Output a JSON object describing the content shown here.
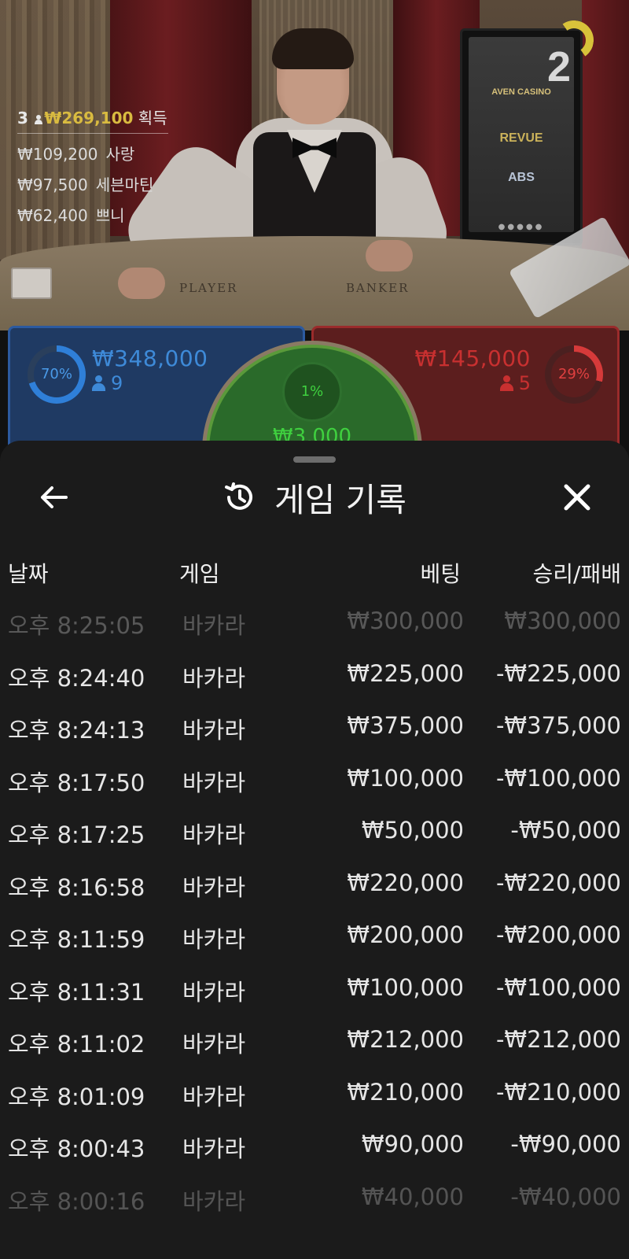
{
  "live": {
    "round_number": "2",
    "table_labels": {
      "player": "PLAYER",
      "banker": "BANKER"
    },
    "sponsors": [
      "AVEN CASINO",
      "REVUE",
      "ABS"
    ],
    "winners": {
      "count": "3",
      "total": "₩269,100",
      "suffix": "획득",
      "list": [
        {
          "amount": "₩109,200",
          "name": "사랑"
        },
        {
          "amount": "₩97,500",
          "name": "세븐마틴"
        },
        {
          "amount": "₩62,400",
          "name": "쁘니"
        }
      ]
    }
  },
  "bets": {
    "player": {
      "percent": "70%",
      "amount": "₩348,000",
      "players": "9",
      "color": "#2f7fd8"
    },
    "banker": {
      "percent": "29%",
      "amount": "₩145,000",
      "players": "5",
      "color": "#d63a3a"
    },
    "tie": {
      "percent": "1%",
      "amount": "₩3,000",
      "color": "#3fd03f"
    }
  },
  "history": {
    "title": "게임 기록",
    "icons": {
      "back": "arrow-left-icon",
      "title": "history-icon",
      "close": "close-icon"
    },
    "columns": {
      "date": "날짜",
      "game": "게임",
      "bet": "베팅",
      "result": "승리/패배"
    },
    "rows": [
      {
        "date": "오후 8:25:05",
        "game": "바카라",
        "bet": "₩300,000",
        "result": "₩300,000"
      },
      {
        "date": "오후 8:24:40",
        "game": "바카라",
        "bet": "₩225,000",
        "result": "-₩225,000"
      },
      {
        "date": "오후 8:24:13",
        "game": "바카라",
        "bet": "₩375,000",
        "result": "-₩375,000"
      },
      {
        "date": "오후 8:17:50",
        "game": "바카라",
        "bet": "₩100,000",
        "result": "-₩100,000"
      },
      {
        "date": "오후 8:17:25",
        "game": "바카라",
        "bet": "₩50,000",
        "result": "-₩50,000"
      },
      {
        "date": "오후 8:16:58",
        "game": "바카라",
        "bet": "₩220,000",
        "result": "-₩220,000"
      },
      {
        "date": "오후 8:11:59",
        "game": "바카라",
        "bet": "₩200,000",
        "result": "-₩200,000"
      },
      {
        "date": "오후 8:11:31",
        "game": "바카라",
        "bet": "₩100,000",
        "result": "-₩100,000"
      },
      {
        "date": "오후 8:11:02",
        "game": "바카라",
        "bet": "₩212,000",
        "result": "-₩212,000"
      },
      {
        "date": "오후 8:01:09",
        "game": "바카라",
        "bet": "₩210,000",
        "result": "-₩210,000"
      },
      {
        "date": "오후 8:00:43",
        "game": "바카라",
        "bet": "₩90,000",
        "result": "-₩90,000"
      },
      {
        "date": "오후 8:00:16",
        "game": "바카라",
        "bet": "₩40,000",
        "result": "-₩40,000"
      }
    ]
  }
}
